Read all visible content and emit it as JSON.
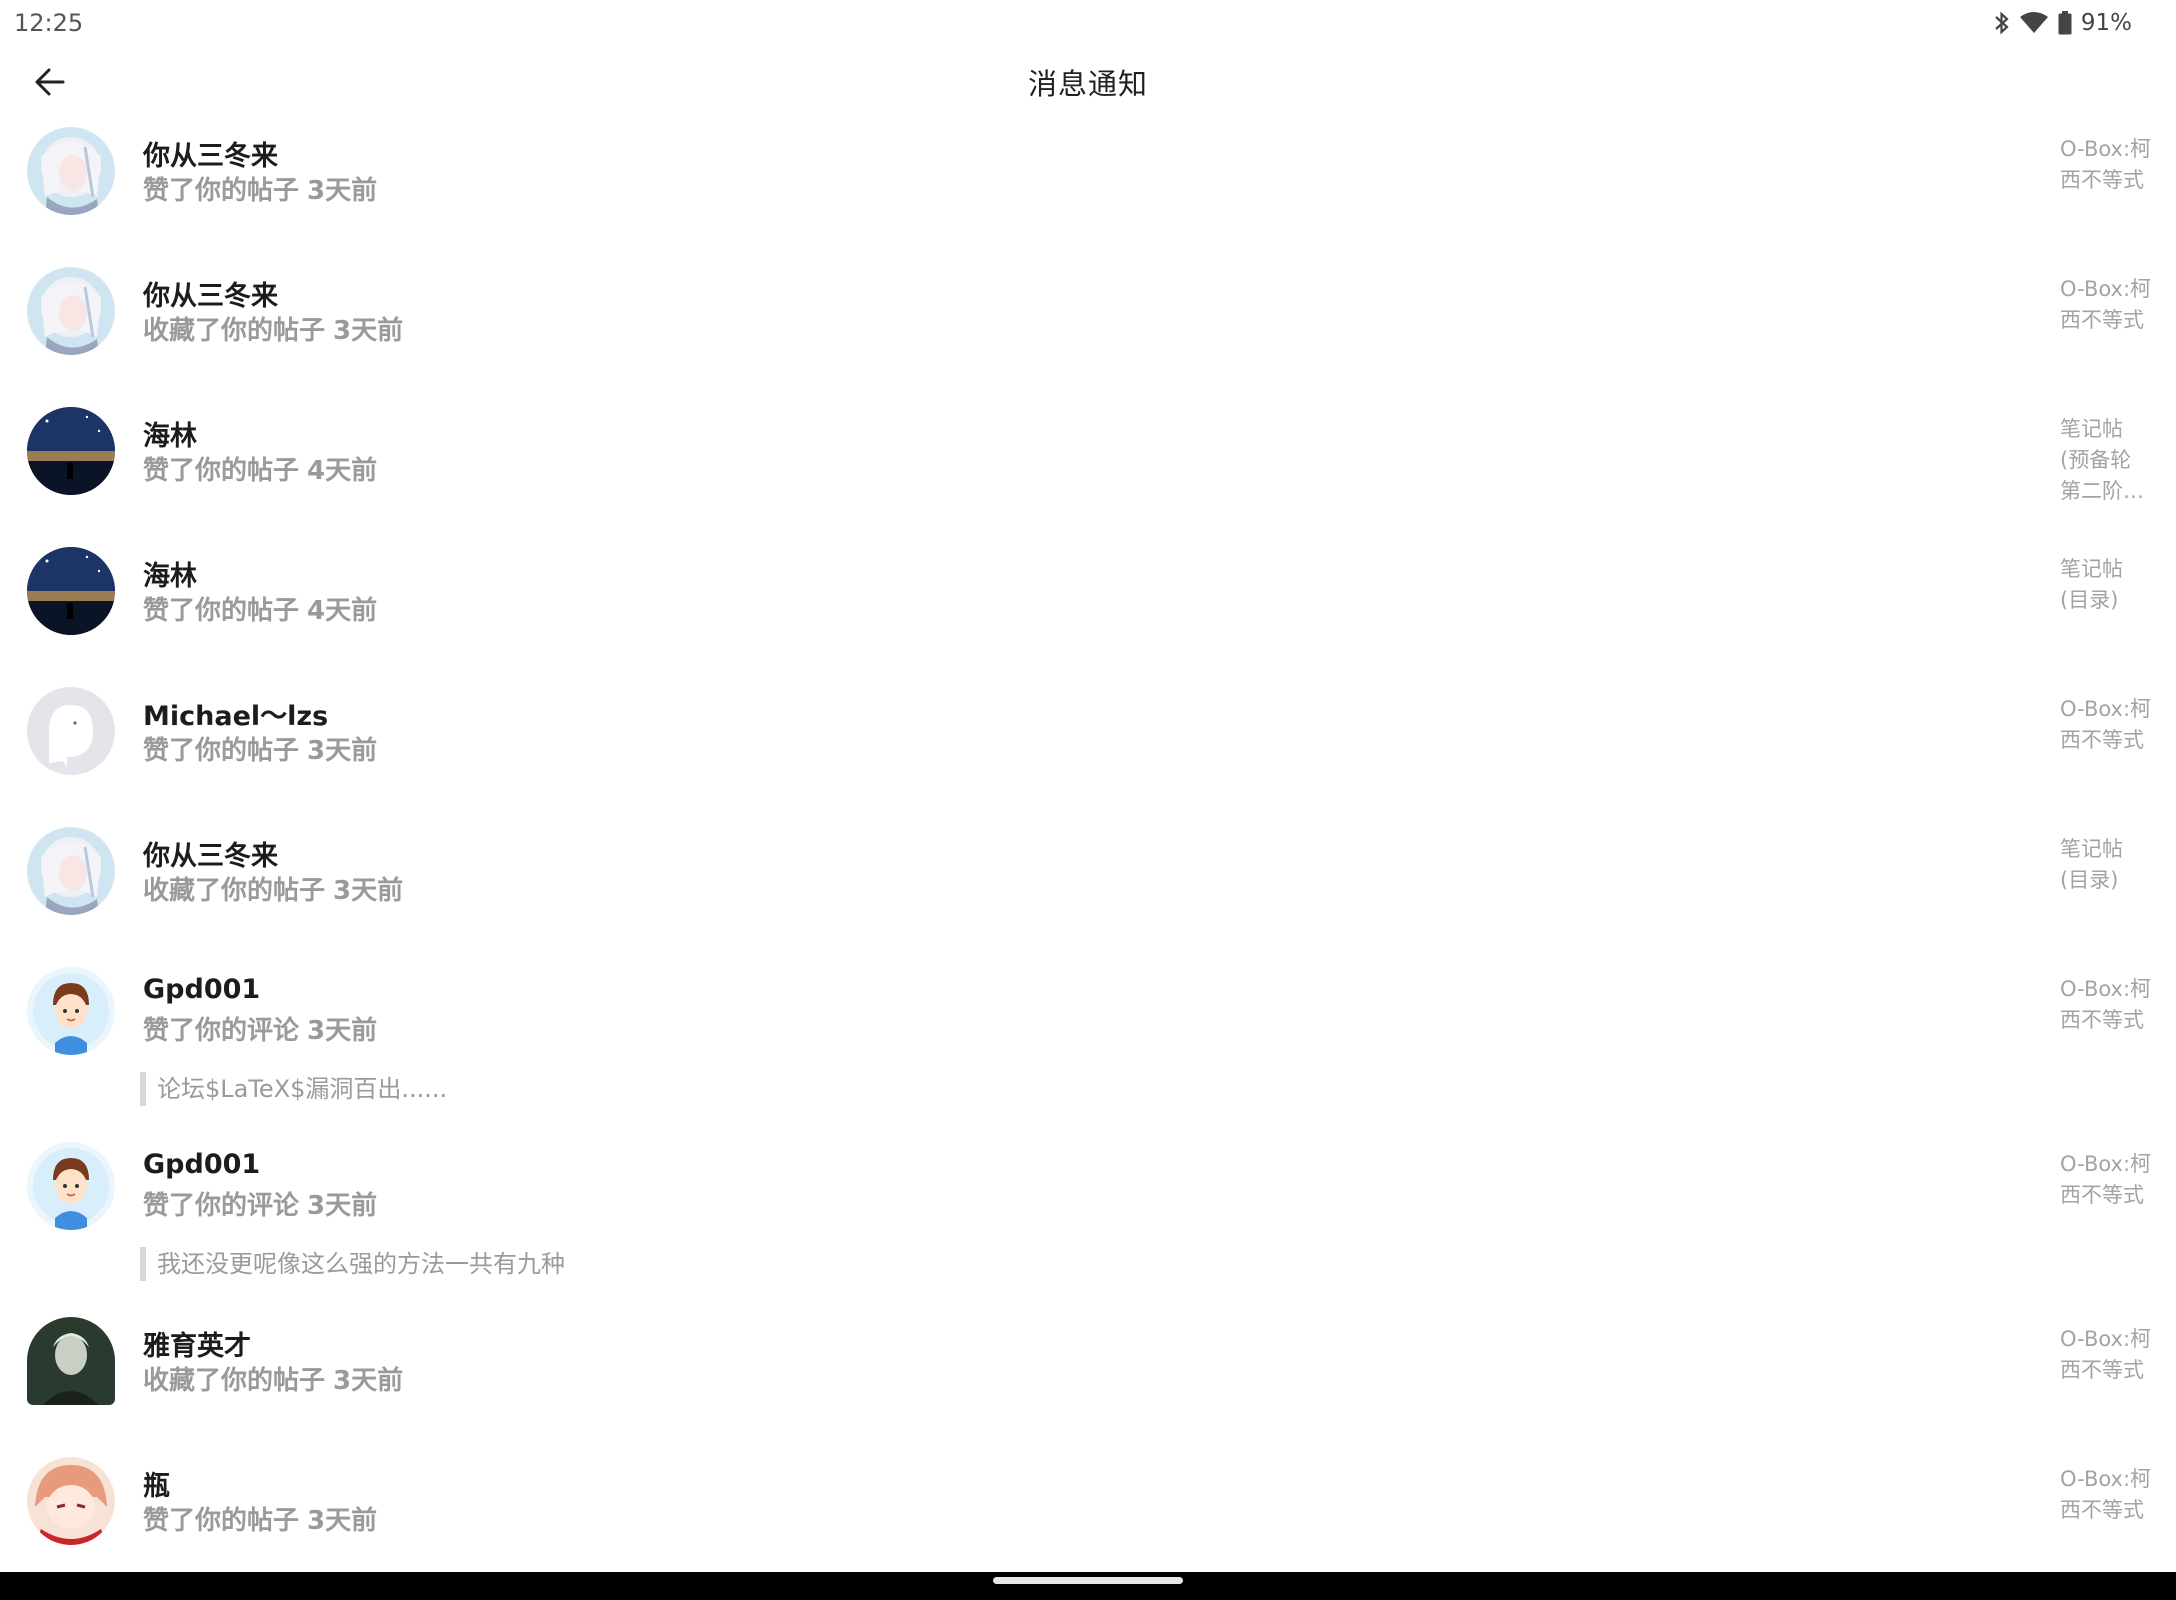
{
  "status_bar": {
    "time": "12:25",
    "icons": [
      "bluetooth-icon",
      "wifi-icon",
      "battery-icon"
    ],
    "battery": "91%"
  },
  "app_bar": {
    "back_icon": "arrow-left-icon",
    "title": "消息通知"
  },
  "notifications": [
    {
      "user": "你从三冬来",
      "action": "赞了你的帖子",
      "time": "3天前",
      "avatar": "anime-girl-white-hair",
      "target": [
        "O-Box:柯",
        "西不等式"
      ]
    },
    {
      "user": "你从三冬来",
      "action": "收藏了你的帖子",
      "time": "3天前",
      "avatar": "anime-girl-white-hair",
      "target": [
        "O-Box:柯",
        "西不等式"
      ]
    },
    {
      "user": "海林",
      "action": "赞了你的帖子",
      "time": "4天前",
      "avatar": "night-sky-scene",
      "target": [
        "笔记帖",
        "(预备轮",
        "第二阶…"
      ]
    },
    {
      "user": "海林",
      "action": "赞了你的帖子",
      "time": "4天前",
      "avatar": "night-sky-scene",
      "target": [
        "笔记帖",
        "(目录)"
      ]
    },
    {
      "user": "Michael～lzs",
      "action": "赞了你的帖子",
      "time": "3天前",
      "avatar": "default-ghost",
      "target": [
        "O-Box:柯",
        "西不等式"
      ]
    },
    {
      "user": "你从三冬来",
      "action": "收藏了你的帖子",
      "time": "3天前",
      "avatar": "anime-girl-white-hair",
      "target": [
        "笔记帖",
        "(目录)"
      ]
    },
    {
      "user": "Gpd001",
      "action": "赞了你的评论",
      "time": "3天前",
      "avatar": "cartoon-boy",
      "target": [
        "O-Box:柯",
        "西不等式"
      ],
      "quote": "论坛$LaTeX$漏洞百出......"
    },
    {
      "user": "Gpd001",
      "action": "赞了你的评论",
      "time": "3天前",
      "avatar": "cartoon-boy",
      "target": [
        "O-Box:柯",
        "西不等式"
      ],
      "quote": "我还没更呢像这么强的方法一共有九种"
    },
    {
      "user": "雅育英才",
      "action": "收藏了你的帖子",
      "time": "3天前",
      "avatar": "dark-portrait",
      "target": [
        "O-Box:柯",
        "西不等式"
      ]
    },
    {
      "user": "瓶",
      "action": "赞了你的帖子",
      "time": "3天前",
      "avatar": "anime-girl-red-scarf",
      "target": [
        "O-Box:柯",
        "西不等式"
      ]
    }
  ],
  "colors": {
    "name": "#1c1c1c",
    "secondary": "#9a9a9a",
    "quote_bar": "#d8d8d8",
    "nav_bar": "#000000"
  }
}
